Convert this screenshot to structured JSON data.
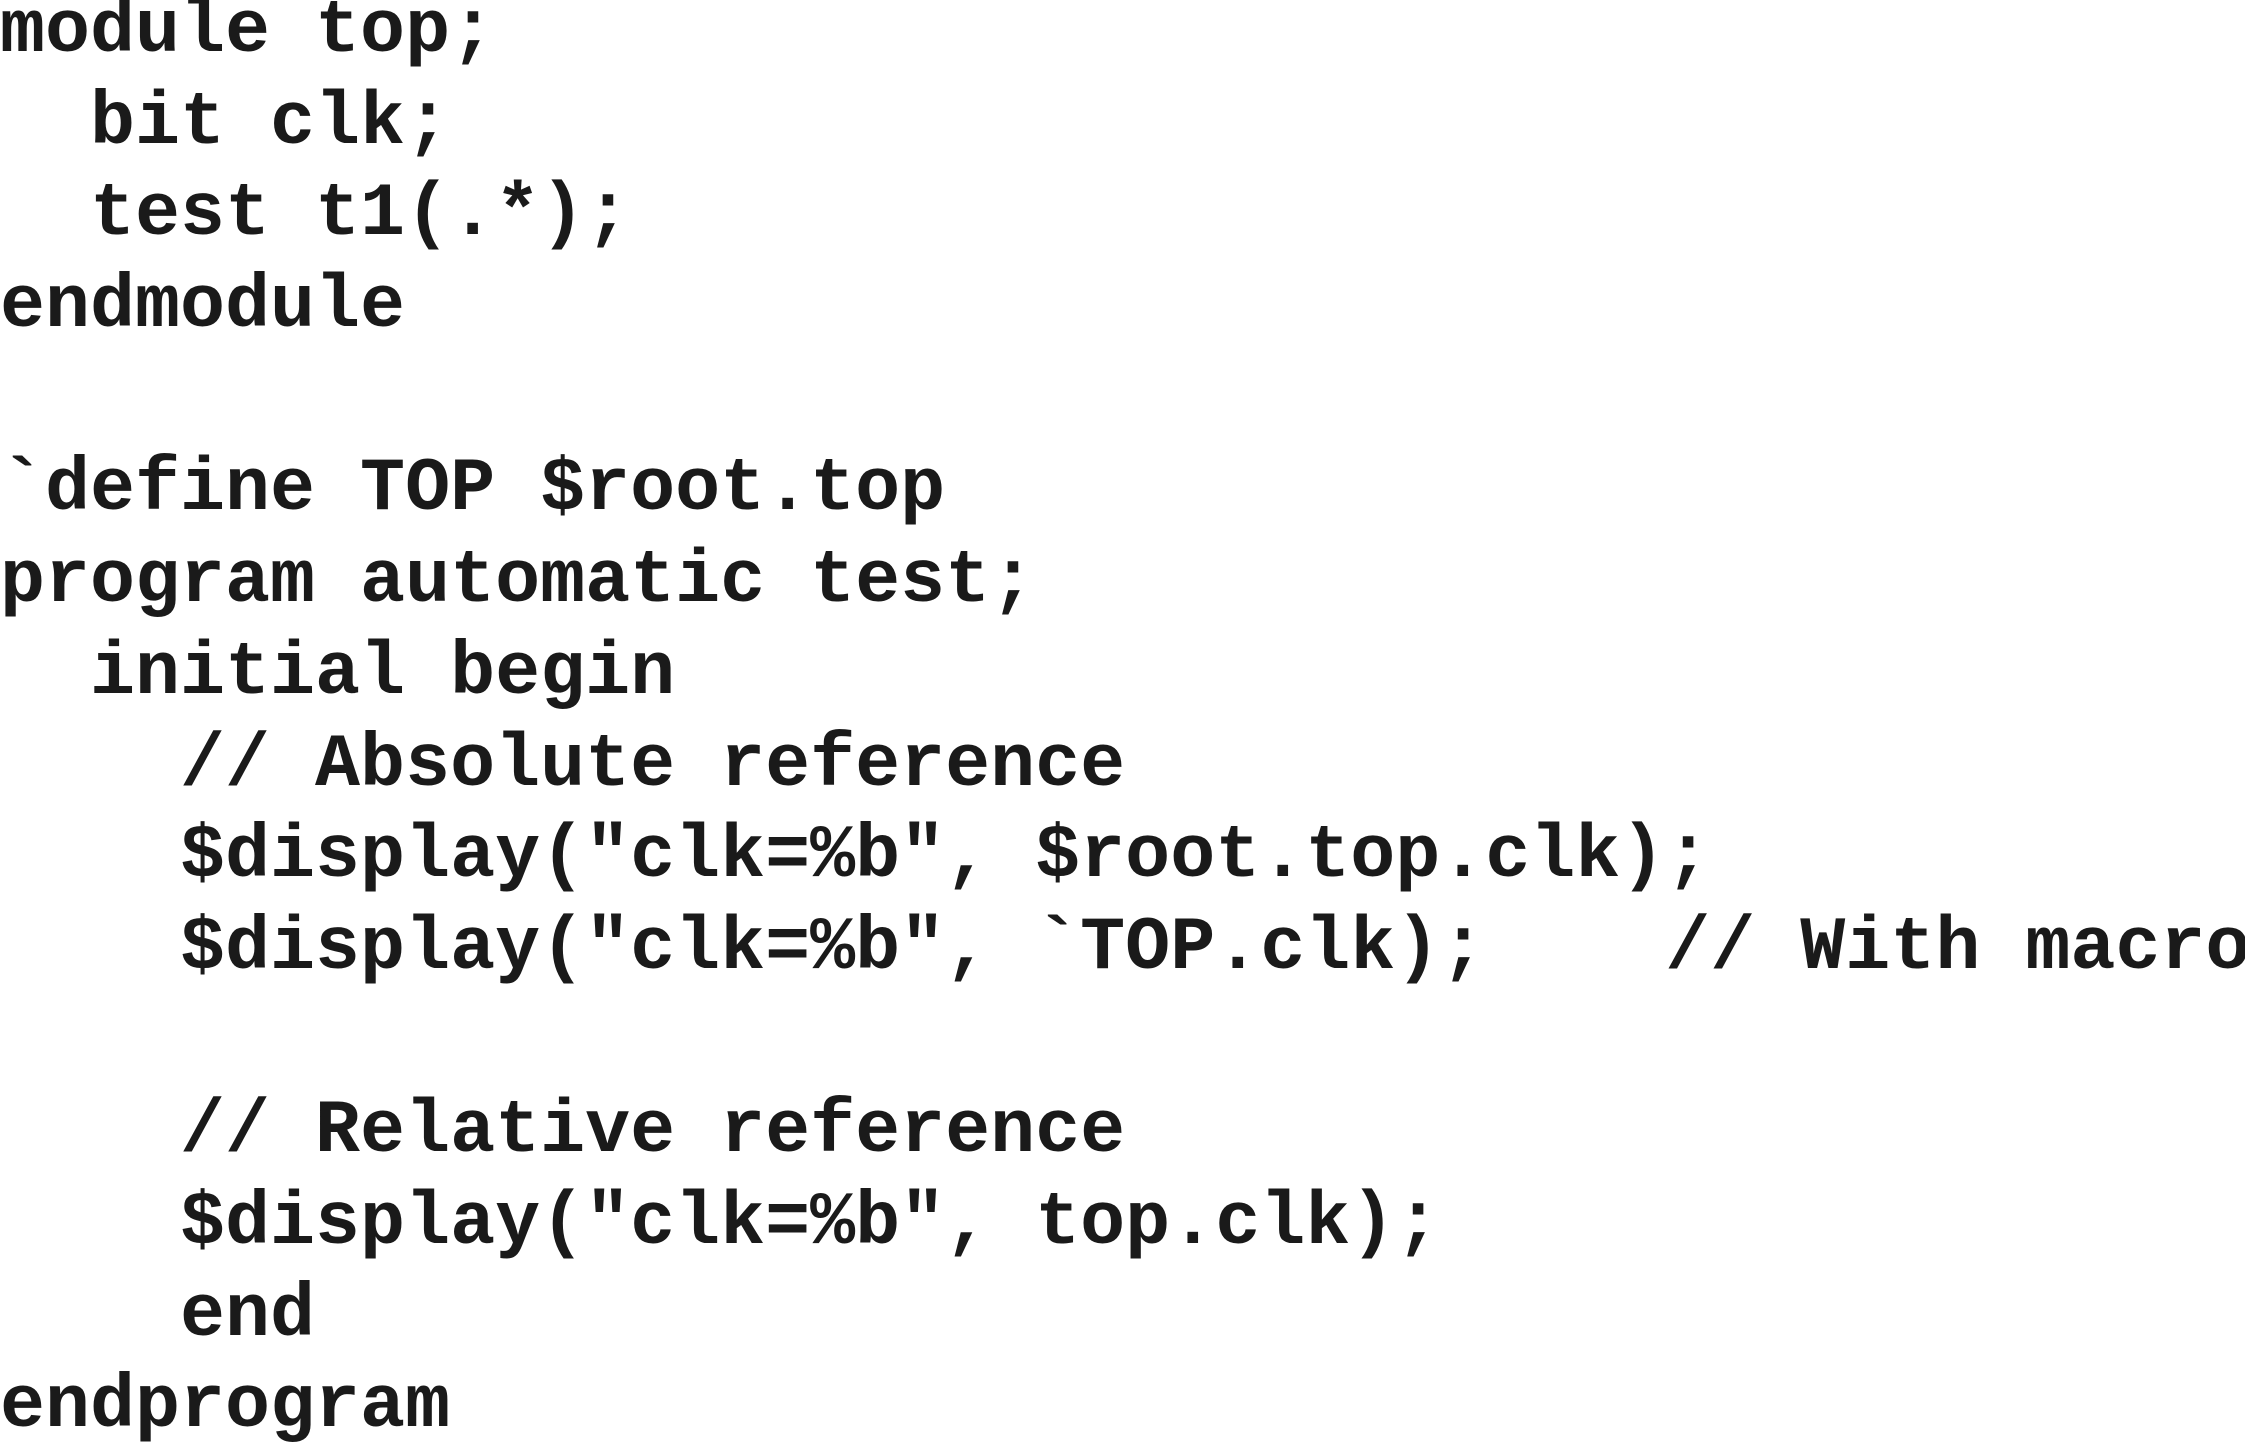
{
  "code": {
    "lines": [
      "module top;",
      "  bit clk;",
      "  test t1(.*);",
      "endmodule",
      "",
      "`define TOP $root.top",
      "program automatic test;",
      "  initial begin",
      "    // Absolute reference",
      "    $display(\"clk=%b\", $root.top.clk);",
      "    $display(\"clk=%b\", `TOP.clk);    // With macro",
      "",
      "    // Relative reference",
      "    $display(\"clk=%b\", top.clk);",
      "    end",
      "endprogram"
    ]
  }
}
